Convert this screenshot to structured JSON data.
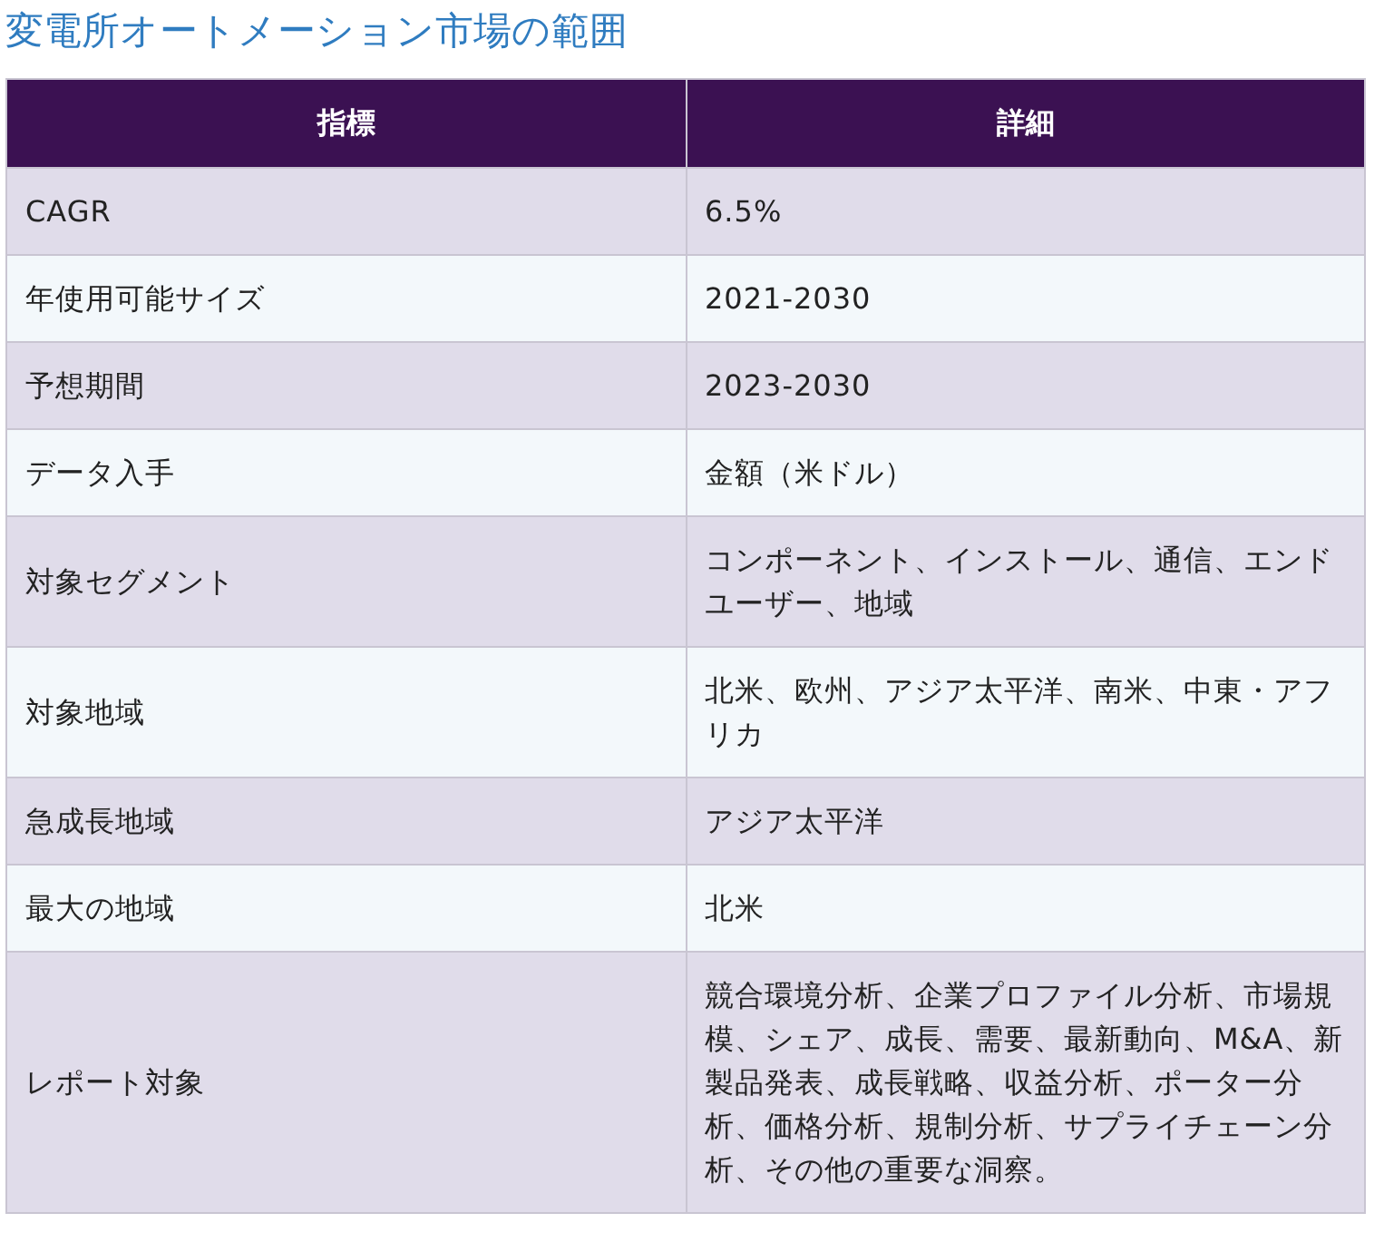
{
  "title": "変電所オートメーション市場の範囲",
  "table": {
    "columns": [
      "指標",
      "詳細"
    ],
    "rows": [
      {
        "metric": "CAGR",
        "detail": "6.5%"
      },
      {
        "metric": "年使用可能サイズ",
        "detail": "2021-2030"
      },
      {
        "metric": "予想期間",
        "detail": "2023-2030"
      },
      {
        "metric": "データ入手",
        "detail": "金額（米ドル）"
      },
      {
        "metric": "対象セグメント",
        "detail": "コンポーネント、インストール、通信、エンドユーザー、地域"
      },
      {
        "metric": "対象地域",
        "detail": "北米、欧州、アジア太平洋、南米、中東・アフリカ"
      },
      {
        "metric": "急成長地域",
        "detail": "アジア太平洋"
      },
      {
        "metric": "最大の地域",
        "detail": "北米"
      },
      {
        "metric": "レポート対象",
        "detail": "競合環境分析、企業プロファイル分析、市場規模、シェア、成長、需要、最新動向、M&A、新製品発表、成長戦略、収益分析、ポーター分析、価格分析、規制分析、サプライチェーン分析、その他の重要な洞察。"
      }
    ]
  }
}
